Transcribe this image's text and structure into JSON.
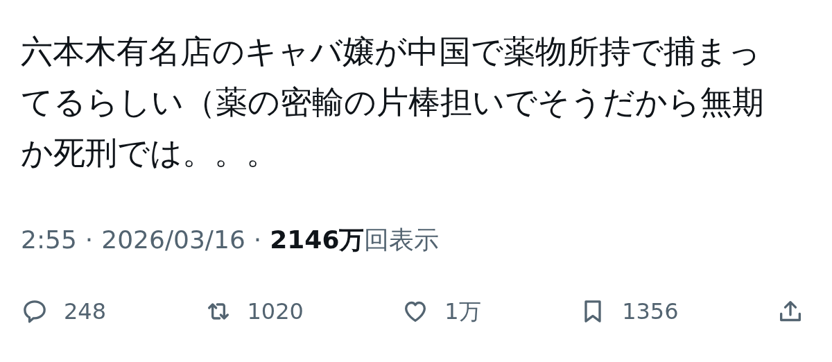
{
  "post": {
    "text": "六本木有名店のキャバ嬢が中国で薬物所持で捕まってるらしい（薬の密輸の片棒担いでそうだから無期か死刑では。。。"
  },
  "meta": {
    "time": "2:55",
    "separator": "·",
    "date": "2026/03/16",
    "views_count": "2146万",
    "views_label": "回表示"
  },
  "actions": [
    {
      "kind": "reply",
      "count": "248"
    },
    {
      "kind": "repost",
      "count": "1020"
    },
    {
      "kind": "like",
      "count": "1万"
    },
    {
      "kind": "bookmark",
      "count": "1356"
    },
    {
      "kind": "share"
    }
  ]
}
